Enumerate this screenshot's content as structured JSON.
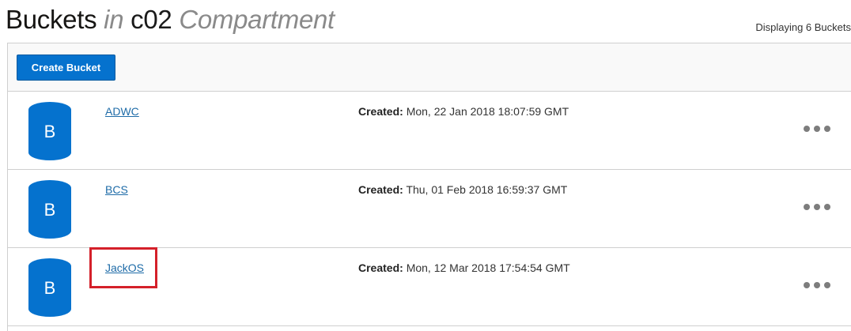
{
  "header": {
    "title_prefix": "Buckets",
    "title_in": "in",
    "compartment": "c02",
    "title_suffix": "Compartment"
  },
  "display_count": "Displaying 6 Buckets",
  "toolbar": {
    "create_label": "Create Bucket"
  },
  "buckets": [
    {
      "icon_letter": "B",
      "name": "ADWC",
      "created_label": "Created:",
      "created": "Mon, 22 Jan 2018 18:07:59 GMT"
    },
    {
      "icon_letter": "B",
      "name": "BCS",
      "created_label": "Created:",
      "created": "Thu, 01 Feb 2018 16:59:37 GMT"
    },
    {
      "icon_letter": "B",
      "name": "JackOS",
      "created_label": "Created:",
      "created": "Mon, 12 Mar 2018 17:54:54 GMT"
    }
  ],
  "colors": {
    "accent": "#0572ce",
    "link": "#1f6ca8",
    "highlight": "#d4202a"
  },
  "icons": {
    "row_icon": "bucket-icon",
    "row_actions": "more-actions-icon"
  }
}
